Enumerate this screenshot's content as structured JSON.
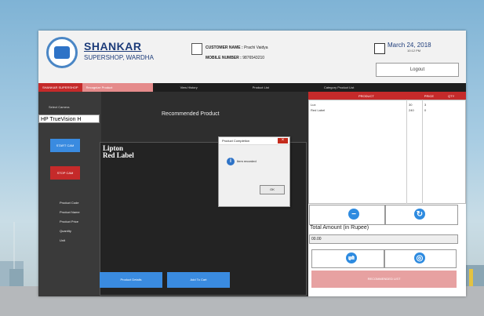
{
  "header": {
    "brand_name": "SHANKAR",
    "brand_sub": "SUPERSHOP, WARDHA",
    "customer_name_label": "CUSTOMER NAME :",
    "customer_name_value": "Prachi Vaidya",
    "mobile_label": "MOBILE NUMBER :",
    "mobile_value": "9876543210",
    "date": "March 24, 2018",
    "time": "10:12 PM",
    "logout_label": "Logout"
  },
  "nav": {
    "tabs": [
      {
        "label": "SHANKAR SUPERSHOP"
      },
      {
        "label": "Recognize Product"
      },
      {
        "label": "View History"
      },
      {
        "label": "Product List"
      },
      {
        "label": "Category Product List"
      }
    ]
  },
  "sidebar": {
    "camera_label": "Select Camera",
    "camera_value": "HP TrueVision H",
    "start_cam": "START CAM",
    "stop_cam": "STOP CAM",
    "fields": [
      "Product Code",
      "Product Name",
      "Product Price",
      "Quantity",
      "Unit"
    ]
  },
  "center": {
    "title": "Recommended Product",
    "detected": [
      "Lipton",
      "Red Label"
    ],
    "product_details_btn": "Product Details",
    "add_to_cart_btn": "Add To Cart"
  },
  "dialog": {
    "title": "Product Completion",
    "message": "Item recorded",
    "ok": "OK",
    "close": "×"
  },
  "cart": {
    "headers": [
      "PRODUCT",
      "PRICE",
      "QTY"
    ],
    "rows": [
      {
        "product": "Lux",
        "price": "30",
        "qty": "3"
      },
      {
        "product": "Red Label",
        "price": "240",
        "qty": "0"
      }
    ],
    "total_label": "Total Amount (in Rupee)",
    "total_value": "00.00",
    "recommend_btn": "RECOMMENDED LIST"
  },
  "colors": {
    "accent_red": "#c52a2a",
    "accent_blue": "#3a8be0",
    "dark_bg": "#3a3a3a"
  }
}
